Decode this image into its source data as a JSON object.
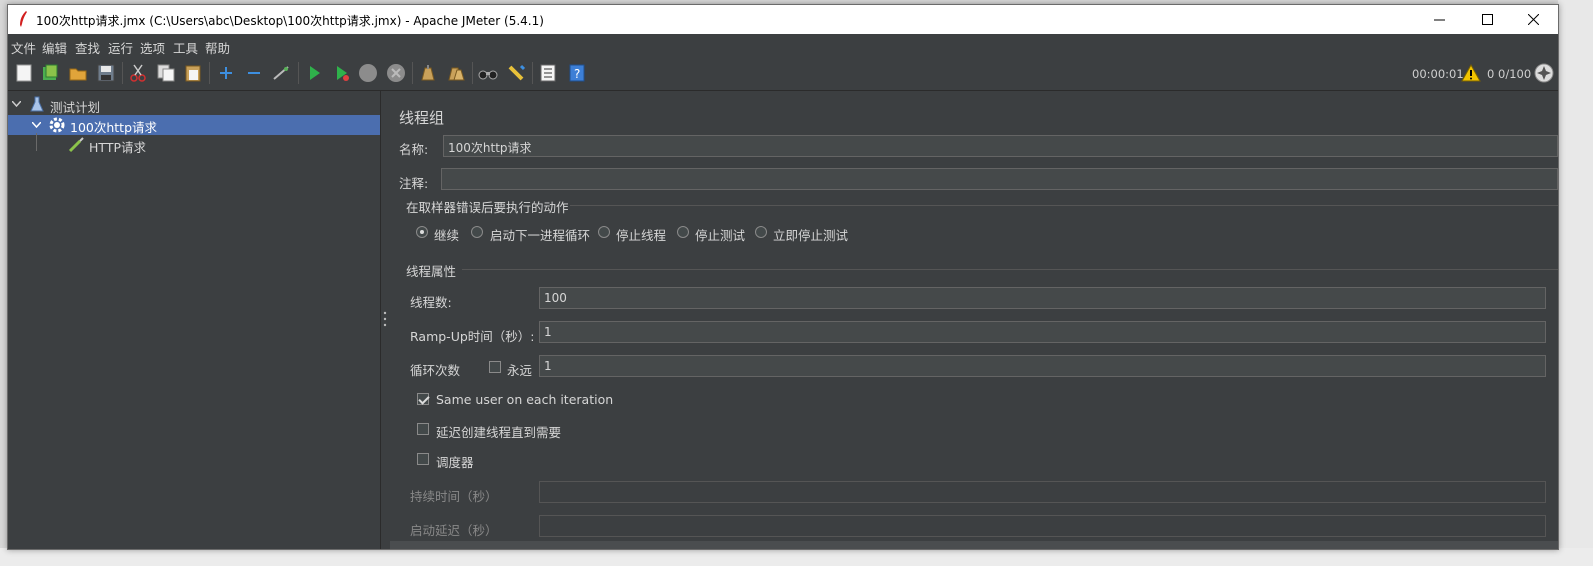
{
  "window": {
    "title": "100次http请求.jmx (C:\\Users\\abc\\Desktop\\100次http请求.jmx) - Apache JMeter (5.4.1)",
    "controls": {
      "minimize": "—",
      "maximize": "☐",
      "close": "✕"
    }
  },
  "menu": [
    "文件",
    "编辑",
    "查找",
    "运行",
    "选项",
    "工具",
    "帮助"
  ],
  "toolbar": {
    "icons": [
      "new-icon",
      "templates-icon",
      "open-icon",
      "save-icon",
      "cut-icon",
      "copy-icon",
      "paste-icon",
      "expand-icon",
      "collapse-icon",
      "toggle-icon",
      "start-icon",
      "start-no-pause-icon",
      "stop-icon",
      "shutdown-icon",
      "clear-icon",
      "clear-all-icon",
      "search-icon",
      "reset-search-icon",
      "function-helper-icon",
      "help-icon"
    ],
    "timer": "00:00:01",
    "error_count": "0",
    "threads": "0/100"
  },
  "tree": {
    "items": [
      {
        "label": "测试计划",
        "icon": "test-plan-icon"
      },
      {
        "label": "100次http请求",
        "icon": "thread-group-gear-icon"
      },
      {
        "label": "HTTP请求",
        "icon": "sampler-pipette-icon"
      }
    ]
  },
  "form": {
    "heading": "线程组",
    "name_label": "名称:",
    "name_value": "100次http请求",
    "comment_label": "注释:",
    "comment_value": "",
    "error_action": {
      "title": "在取样器错误后要执行的动作",
      "options": [
        "继续",
        "启动下一进程循环",
        "停止线程",
        "停止测试",
        "立即停止测试"
      ],
      "selected": "继续"
    },
    "thread_props": {
      "title": "线程属性",
      "threads_label": "线程数:",
      "threads_value": "100",
      "ramp_label": "Ramp-Up时间（秒）:",
      "ramp_value": "1",
      "loop_label": "循环次数",
      "forever_label": "永远",
      "forever_checked": false,
      "loop_value": "1",
      "same_user_label": "Same user on each iteration",
      "same_user_checked": true,
      "delay_label": "延迟创建线程直到需要",
      "delay_checked": false,
      "scheduler_label": "调度器",
      "scheduler_checked": false,
      "duration_label": "持续时间（秒）",
      "duration_value": "",
      "startup_delay_label": "启动延迟（秒）",
      "startup_delay_value": ""
    }
  },
  "colors": {
    "background": "#3c3f41",
    "selection": "#4b6eaf",
    "text": "#d6d6d6"
  }
}
